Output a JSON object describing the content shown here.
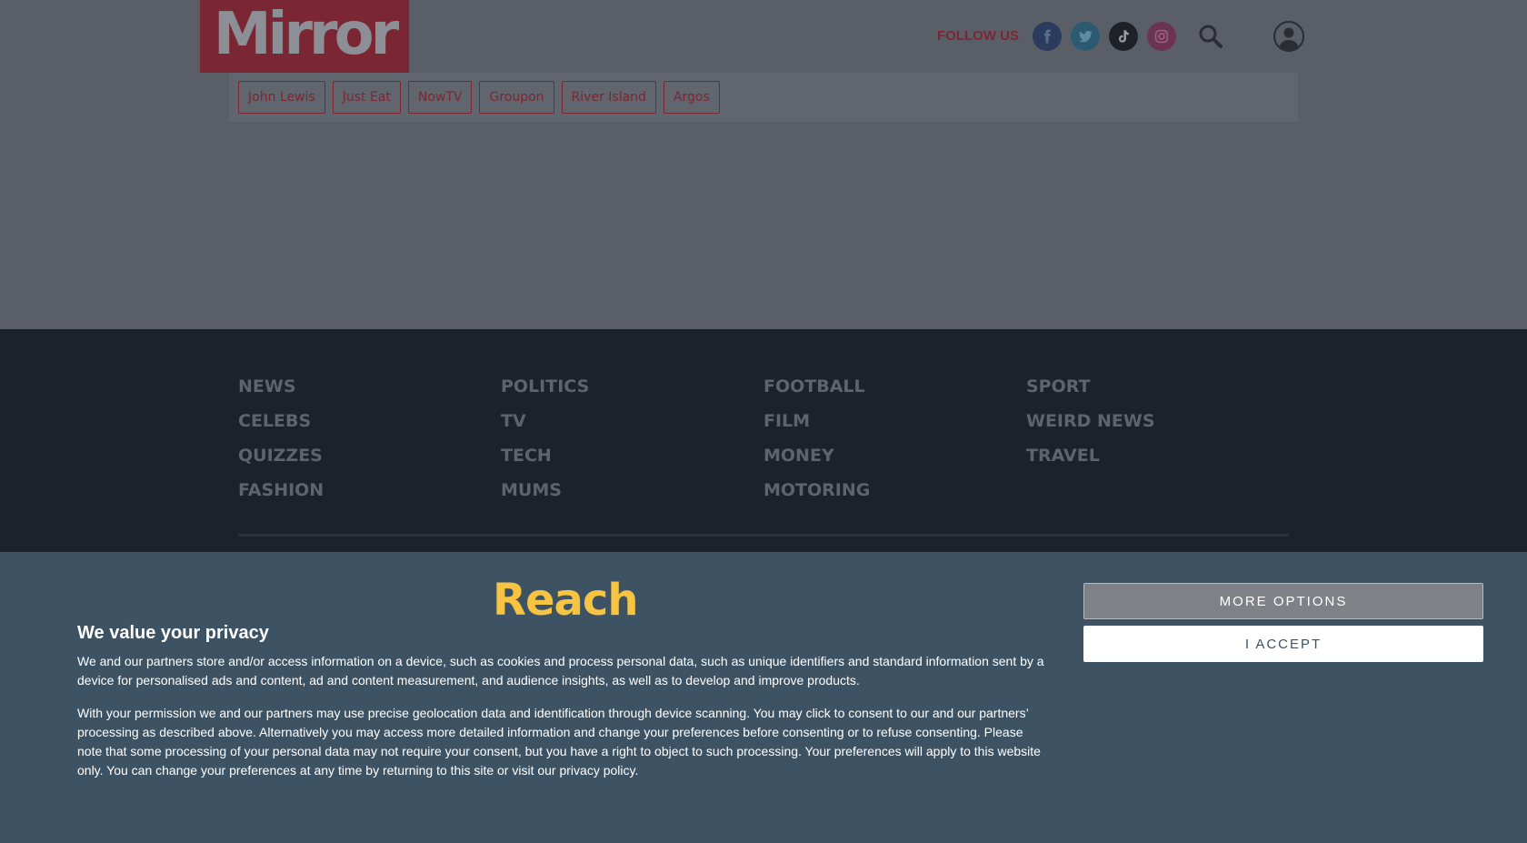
{
  "header": {
    "logo_text": "Mirror",
    "follow_label": "FOLLOW US",
    "social": [
      {
        "icon": "facebook-icon",
        "color": "#2c3c5e"
      },
      {
        "icon": "twitter-icon",
        "color": "#2b5a72"
      },
      {
        "icon": "tiktok-icon",
        "color": "#1e2128"
      },
      {
        "icon": "instagram-icon",
        "color": "#6b3352"
      }
    ],
    "search_icon": "search-icon",
    "account_icon": "user-icon",
    "brand_color": "#7a2733"
  },
  "merchants": [
    "John Lewis",
    "Just Eat",
    "NowTV",
    "Groupon",
    "River Island",
    "Argos"
  ],
  "footer_nav": {
    "col1": [
      "NEWS",
      "CELEBS",
      "QUIZZES",
      "FASHION"
    ],
    "col2": [
      "POLITICS",
      "TV",
      "TECH",
      "MUMS"
    ],
    "col3": [
      "FOOTBALL",
      "FILM",
      "MONEY",
      "MOTORING"
    ],
    "col4": [
      "SPORT",
      "WEIRD NEWS",
      "TRAVEL"
    ]
  },
  "consent": {
    "logo_text": "Reach",
    "title": "We value your privacy",
    "paragraph1": "We and our partners store and/or access information on a device, such as cookies and process personal data, such as unique identifiers and standard information sent by a device for personalised ads and content, ad and content measurement, and audience insights, as well as to develop and improve products.",
    "paragraph2": "With your permission we and our partners may use precise geolocation data and identification through device scanning. You may click to consent to our and our partners’ processing as described above. Alternatively you may access more detailed information and change your preferences before consenting or to refuse consenting. Please note that some processing of your personal data may not require your consent, but you have a right to object to such processing. Your preferences will apply to this website only. You can change your preferences at any time by returning to this site or visit our privacy policy.",
    "more_options_label": "MORE OPTIONS",
    "accept_label": "I ACCEPT",
    "accent_color": "#f6c343"
  }
}
